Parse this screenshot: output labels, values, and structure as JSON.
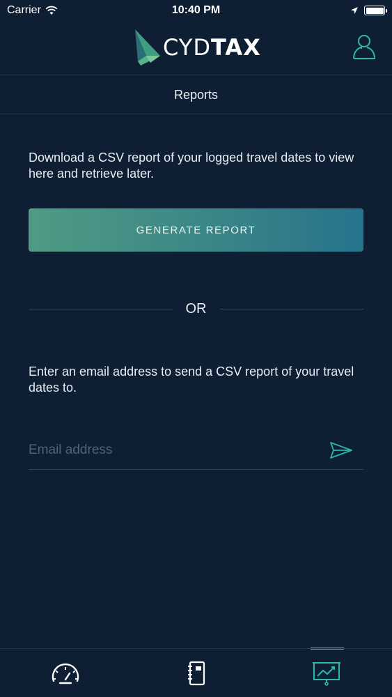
{
  "status_bar": {
    "carrier": "Carrier",
    "time": "10:40 PM",
    "icons": [
      "wifi-icon",
      "location-arrow-icon",
      "battery-icon"
    ]
  },
  "header": {
    "logo_text_thin": "CYD",
    "logo_text_bold": "TAX",
    "profile_icon": "user-icon"
  },
  "page": {
    "title": "Reports"
  },
  "content": {
    "download_description": "Download a CSV report of your logged travel dates to view here and retrieve later.",
    "generate_button_label": "GENERATE REPORT",
    "or_label": "OR",
    "email_description": "Enter an email address to send a CSV report of your travel dates to.",
    "email_placeholder": "Email address",
    "email_value": "",
    "send_icon": "send-icon"
  },
  "tab_bar": {
    "tabs": [
      {
        "icon": "speedometer-icon",
        "active": false
      },
      {
        "icon": "notebook-icon",
        "active": false
      },
      {
        "icon": "reports-chart-icon",
        "active": true
      }
    ]
  },
  "colors": {
    "background": "#0f1f33",
    "accent": "#2bb8aa",
    "button_gradient_start": "#4f9b85",
    "button_gradient_end": "#27738c",
    "divider": "#223549"
  }
}
